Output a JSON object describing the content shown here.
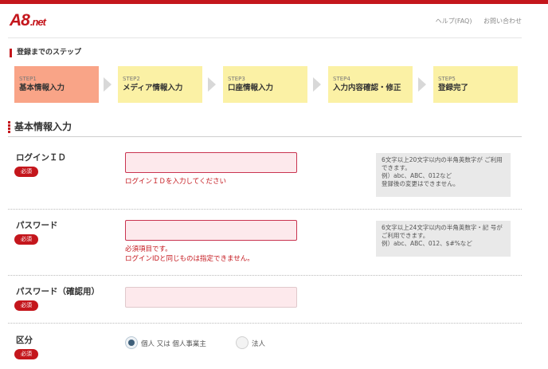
{
  "header": {
    "logo_main": "A8",
    "logo_suffix": ".net",
    "links": [
      "ヘルプ(FAQ)",
      "お問い合わせ"
    ]
  },
  "steps_heading": "登録までのステップ",
  "steps": [
    {
      "label": "STEP1",
      "name": "基本情報入力",
      "active": true
    },
    {
      "label": "STEP2",
      "name": "メディア情報入力",
      "active": false
    },
    {
      "label": "STEP3",
      "name": "口座情報入力",
      "active": false
    },
    {
      "label": "STEP4",
      "name": "入力内容確認・修正",
      "active": false
    },
    {
      "label": "STEP5",
      "name": "登録完了",
      "active": false
    }
  ],
  "section_title": "基本情報入力",
  "required_badge": "必須",
  "form": {
    "login_id": {
      "label": "ログインＩＤ",
      "value": "",
      "error": "ログインＩＤを入力してください",
      "hint_lines": [
        "6文字以上20文字以内の半角英数字が ご利用できます。",
        "例）abc、ABC、012など",
        "登録後の変更はできません。"
      ]
    },
    "password": {
      "label": "パスワード",
      "value": "",
      "errors": [
        "必須項目です。",
        "ログインIDと同じものは指定できません。"
      ],
      "hint_lines": [
        "6文字以上24文字以内の半角英数字・記 号がご利用できます。",
        "例）abc、ABC、012、$#%など"
      ]
    },
    "password_confirm": {
      "label": "パスワード（確認用）",
      "value": ""
    },
    "category": {
      "label": "区分",
      "options": [
        "個人 又は 個人事業主",
        "法人"
      ],
      "selected": "個人 又は 個人事業主"
    }
  }
}
